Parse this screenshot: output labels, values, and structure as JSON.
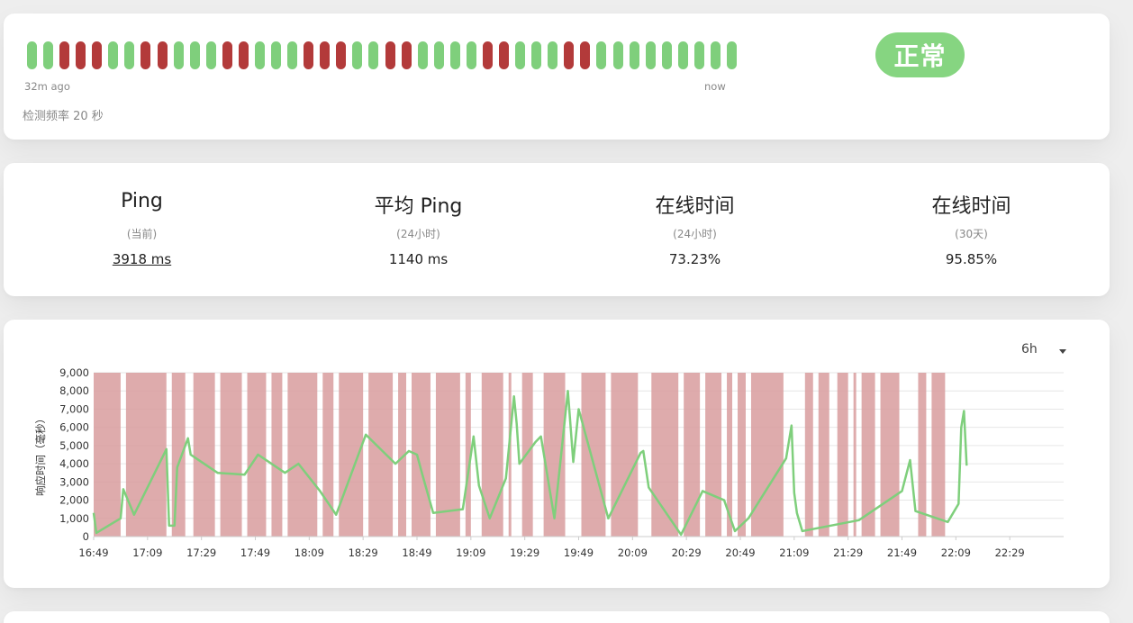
{
  "heartbeat": {
    "beats": [
      "up",
      "up",
      "down",
      "down",
      "down",
      "up",
      "up",
      "down",
      "down",
      "up",
      "up",
      "up",
      "down",
      "down",
      "up",
      "up",
      "up",
      "down",
      "down",
      "down",
      "up",
      "up",
      "down",
      "down",
      "up",
      "up",
      "up",
      "up",
      "down",
      "down",
      "up",
      "up",
      "up",
      "down",
      "down",
      "up",
      "up",
      "up",
      "up",
      "up",
      "up",
      "up",
      "up",
      "up"
    ],
    "time_start": "32m ago",
    "time_end": "now",
    "frequency_label": "检测频率 20 秒",
    "status_label": "正常"
  },
  "stats": [
    {
      "title": "Ping",
      "sub": "(当前)",
      "value": "3918 ms",
      "link": true
    },
    {
      "title": "平均 Ping",
      "sub": "(24小时)",
      "value": "1140 ms",
      "link": false
    },
    {
      "title": "在线时间",
      "sub": "(24小时)",
      "value": "73.23%",
      "link": false
    },
    {
      "title": "在线时间",
      "sub": "(30天)",
      "value": "95.85%",
      "link": false
    }
  ],
  "chart": {
    "range_label": "6h"
  },
  "colors": {
    "up": "#7fcf7c",
    "down": "#b33a3a",
    "badge": "#86d581",
    "downtime_fill": "#d89c9d",
    "line": "#7fcf7c"
  },
  "chart_data": {
    "type": "line",
    "ylabel": "响应时间（毫秒）",
    "ylim": [
      0,
      9000
    ],
    "y_ticks": [
      "9,000",
      "8,000",
      "7,000",
      "6,000",
      "5,000",
      "4,000",
      "3,000",
      "2,000",
      "1,000",
      "0"
    ],
    "x_ticks": [
      "16:49",
      "17:09",
      "17:29",
      "17:49",
      "18:09",
      "18:29",
      "18:49",
      "19:09",
      "19:29",
      "19:49",
      "20:09",
      "20:29",
      "20:49",
      "21:09",
      "21:29",
      "21:49",
      "22:09",
      "22:29"
    ],
    "grid": true,
    "series": [
      {
        "kind": "response_time",
        "points": [
          [
            "16:49",
            1300
          ],
          [
            "16:50",
            200
          ],
          [
            "16:59",
            1000
          ],
          [
            "17:00",
            2600
          ],
          [
            "17:04",
            1200
          ],
          [
            "17:16",
            4800
          ],
          [
            "17:17",
            600
          ],
          [
            "17:19",
            600
          ],
          [
            "17:20",
            3800
          ],
          [
            "17:24",
            5400
          ],
          [
            "17:25",
            4500
          ],
          [
            "17:35",
            3500
          ],
          [
            "17:45",
            3400
          ],
          [
            "17:50",
            4500
          ],
          [
            "17:54",
            4100
          ],
          [
            "18:00",
            3500
          ],
          [
            "18:05",
            4000
          ],
          [
            "18:13",
            2500
          ],
          [
            "18:19",
            1200
          ],
          [
            "18:30",
            5600
          ],
          [
            "18:41",
            4000
          ],
          [
            "18:46",
            4700
          ],
          [
            "18:49",
            4500
          ],
          [
            "18:51",
            3400
          ],
          [
            "18:55",
            1300
          ],
          [
            "19:06",
            1500
          ],
          [
            "19:10",
            5500
          ],
          [
            "19:12",
            2800
          ],
          [
            "19:16",
            1000
          ],
          [
            "19:22",
            3200
          ],
          [
            "19:25",
            7700
          ],
          [
            "19:26",
            6200
          ],
          [
            "19:27",
            4000
          ],
          [
            "19:33",
            5200
          ],
          [
            "19:35",
            5500
          ],
          [
            "19:40",
            1000
          ],
          [
            "19:45",
            8000
          ],
          [
            "19:47",
            4100
          ],
          [
            "19:49",
            7000
          ],
          [
            "20:00",
            1000
          ],
          [
            "20:12",
            4600
          ],
          [
            "20:13",
            4700
          ],
          [
            "20:15",
            2700
          ],
          [
            "20:27",
            100
          ],
          [
            "20:35",
            2500
          ],
          [
            "20:43",
            2000
          ],
          [
            "20:47",
            300
          ],
          [
            "20:52",
            1000
          ],
          [
            "21:06",
            4300
          ],
          [
            "21:08",
            6100
          ],
          [
            "21:09",
            2400
          ],
          [
            "21:10",
            1300
          ],
          [
            "21:12",
            300
          ],
          [
            "21:33",
            900
          ],
          [
            "21:49",
            2500
          ],
          [
            "21:52",
            4200
          ],
          [
            "21:54",
            1400
          ],
          [
            "22:06",
            800
          ],
          [
            "22:10",
            1800
          ],
          [
            "22:11",
            6000
          ],
          [
            "22:12",
            6900
          ],
          [
            "22:13",
            3900
          ]
        ]
      }
    ],
    "downtime_intervals": [
      [
        "16:49",
        "16:59"
      ],
      [
        "17:01",
        "17:16"
      ],
      [
        "17:18",
        "17:23"
      ],
      [
        "17:26",
        "17:34"
      ],
      [
        "17:36",
        "17:44"
      ],
      [
        "17:46",
        "17:53"
      ],
      [
        "17:55",
        "17:59"
      ],
      [
        "18:01",
        "18:12"
      ],
      [
        "18:14",
        "18:18"
      ],
      [
        "18:20",
        "18:29"
      ],
      [
        "18:31",
        "18:40"
      ],
      [
        "18:42",
        "18:45"
      ],
      [
        "18:47",
        "18:54"
      ],
      [
        "18:56",
        "19:05"
      ],
      [
        "19:07",
        "19:09"
      ],
      [
        "19:13",
        "19:21"
      ],
      [
        "19:23",
        "19:24"
      ],
      [
        "19:28",
        "19:32"
      ],
      [
        "19:36",
        "19:44"
      ],
      [
        "19:50",
        "19:59"
      ],
      [
        "20:01",
        "20:11"
      ],
      [
        "20:16",
        "20:26"
      ],
      [
        "20:28",
        "20:34"
      ],
      [
        "20:36",
        "20:42"
      ],
      [
        "20:44",
        "20:46"
      ],
      [
        "20:48",
        "20:51"
      ],
      [
        "20:53",
        "21:05"
      ],
      [
        "21:13",
        "21:16"
      ],
      [
        "21:18",
        "21:22"
      ],
      [
        "21:25",
        "21:29"
      ],
      [
        "21:31",
        "21:32"
      ],
      [
        "21:34",
        "21:39"
      ],
      [
        "21:41",
        "21:48"
      ],
      [
        "21:55",
        "21:58"
      ],
      [
        "22:00",
        "22:05"
      ]
    ]
  }
}
